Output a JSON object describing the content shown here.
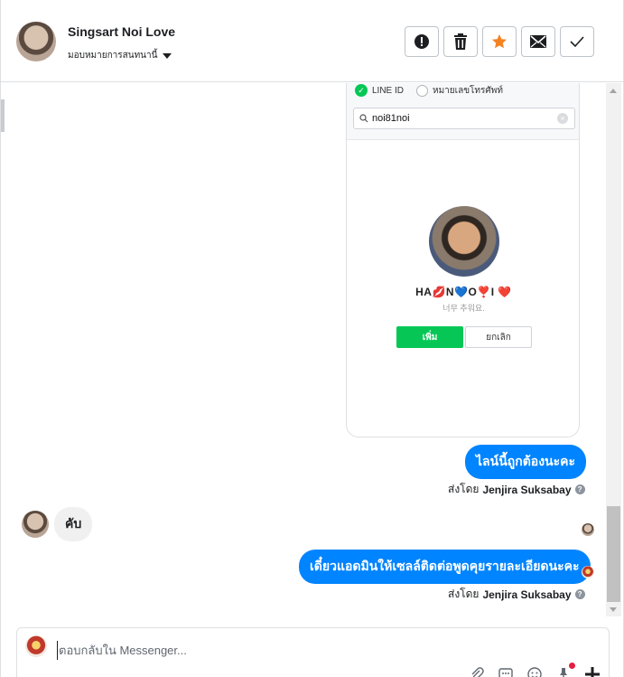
{
  "header": {
    "contact_name": "Singsart Noi Love",
    "assign_label": "มอบหมายการสนทนานี้",
    "actions": [
      "alert-circle-icon",
      "trash-icon",
      "star-icon",
      "envelope-icon",
      "check-icon"
    ],
    "star_color": "#f58220"
  },
  "screenshot": {
    "option_line_id": "LINE ID",
    "option_phone": "หมายเลขโทรศัพท์",
    "search_value": "noi81noi",
    "profile_name": "HA💋N💙O❣️I ❤️",
    "profile_status": "너무 추워요.",
    "add_button": "เพิ่ม",
    "cancel_button": "ยกเลิก",
    "line_green": "#06c755"
  },
  "messages": [
    {
      "direction": "out",
      "text": "ไลน์นี้ถูกต้องนะคะ",
      "sent_by_prefix": "ส่งโดย",
      "sent_by_name": "Jenjira Suksabay"
    },
    {
      "direction": "in",
      "text": "คับ"
    },
    {
      "direction": "out",
      "text": "เดี๋ยวแอดมินให้เซลล์ติดต่อพูดคุยรายละเอียดนะคะ",
      "sent_by_prefix": "ส่งโดย",
      "sent_by_name": "Jenjira Suksabay"
    }
  ],
  "composer": {
    "placeholder": "ตอบกลับใน Messenger...",
    "tools": [
      "paperclip-icon",
      "saved-replies-icon",
      "emoji-icon",
      "pin-icon",
      "sparkle-icon"
    ]
  },
  "colors": {
    "messenger_blue": "#0084ff",
    "incoming_bg": "#f0f0f0"
  }
}
